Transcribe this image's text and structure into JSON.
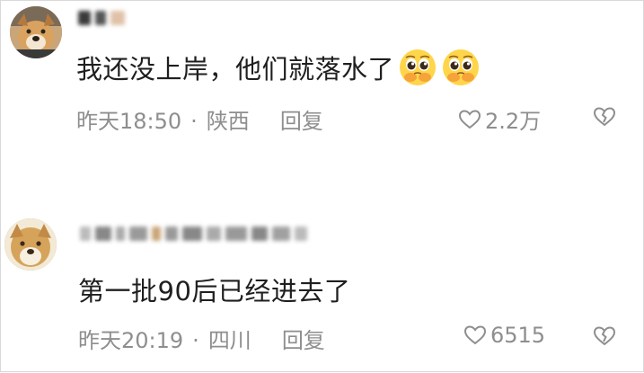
{
  "comments": [
    {
      "username": "",
      "text": "我还没上岸，他们就落水了",
      "emojis": [
        "pleading-face",
        "pleading-face"
      ],
      "time": "昨天18:50",
      "separator": "·",
      "location": "陕西",
      "reply_label": "回复",
      "likes": "2.2万"
    },
    {
      "username": "",
      "text": "第一批90后已经进去了",
      "emojis": [],
      "time": "昨天20:19",
      "separator": "·",
      "location": "四川",
      "reply_label": "回复",
      "likes": "6515"
    }
  ],
  "colors": {
    "text": "#1f1f1f",
    "meta": "#8e8e8e",
    "background": "#ffffff"
  }
}
